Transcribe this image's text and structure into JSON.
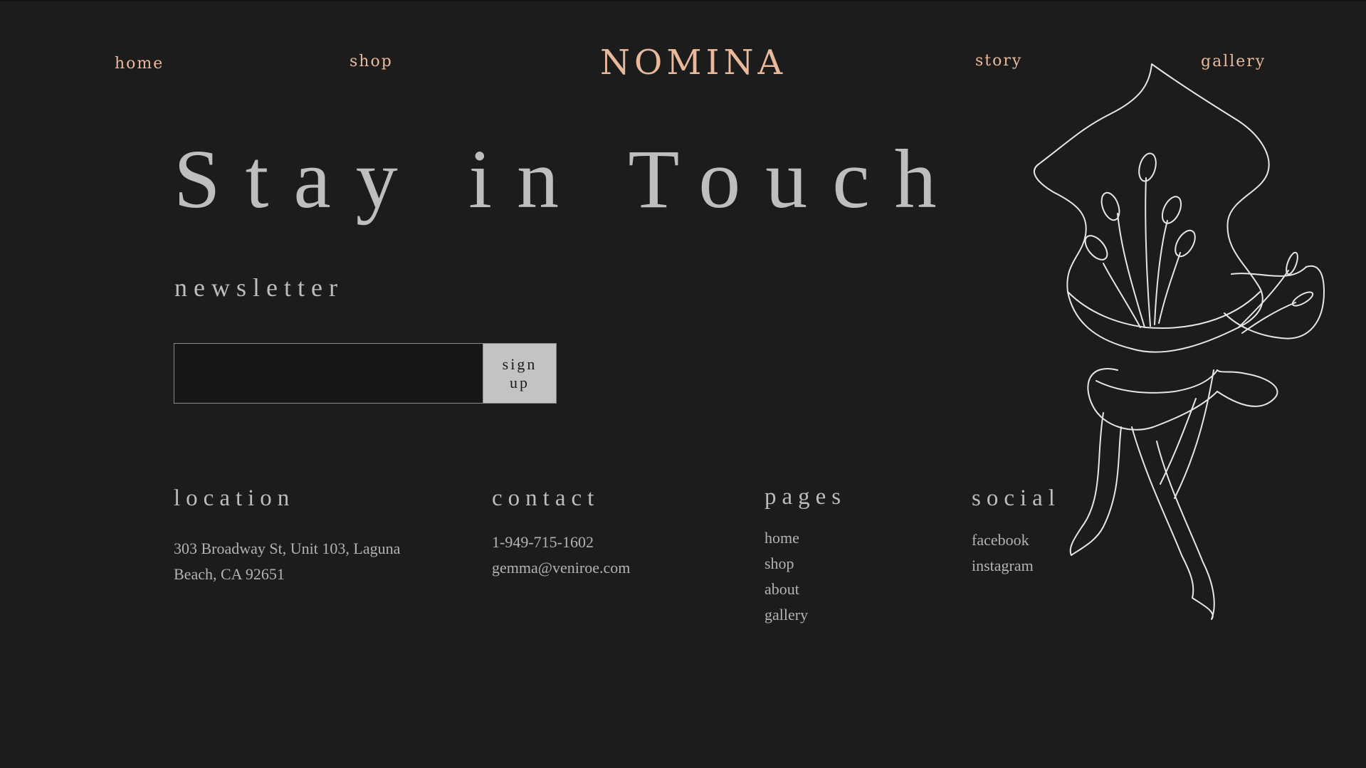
{
  "nav": {
    "home": "home",
    "shop": "shop",
    "logo": "NOMINA",
    "story": "story",
    "gallery": "gallery"
  },
  "hero": {
    "title": "Stay in Touch"
  },
  "newsletter": {
    "label": "newsletter",
    "email_value": "",
    "button_label": "sign up"
  },
  "footer": {
    "location": {
      "title": "location",
      "line1": "303 Broadway St, Unit 103, Laguna",
      "line2": "Beach, CA 92651"
    },
    "contact": {
      "title": "contact",
      "phone": "1-949-715-1602",
      "email": "gemma@veniroe.com"
    },
    "pages": {
      "title": "pages",
      "links": [
        "home",
        "shop",
        "about",
        "gallery"
      ]
    },
    "social": {
      "title": "social",
      "links": [
        "facebook",
        "instagram"
      ]
    }
  },
  "colors": {
    "background": "#1c1c1c",
    "accent": "#e8b99a",
    "text": "#bdbdbd",
    "button": "#c3c3c3"
  },
  "icons": {
    "decoration": "calla-lily-line-art-icon"
  }
}
